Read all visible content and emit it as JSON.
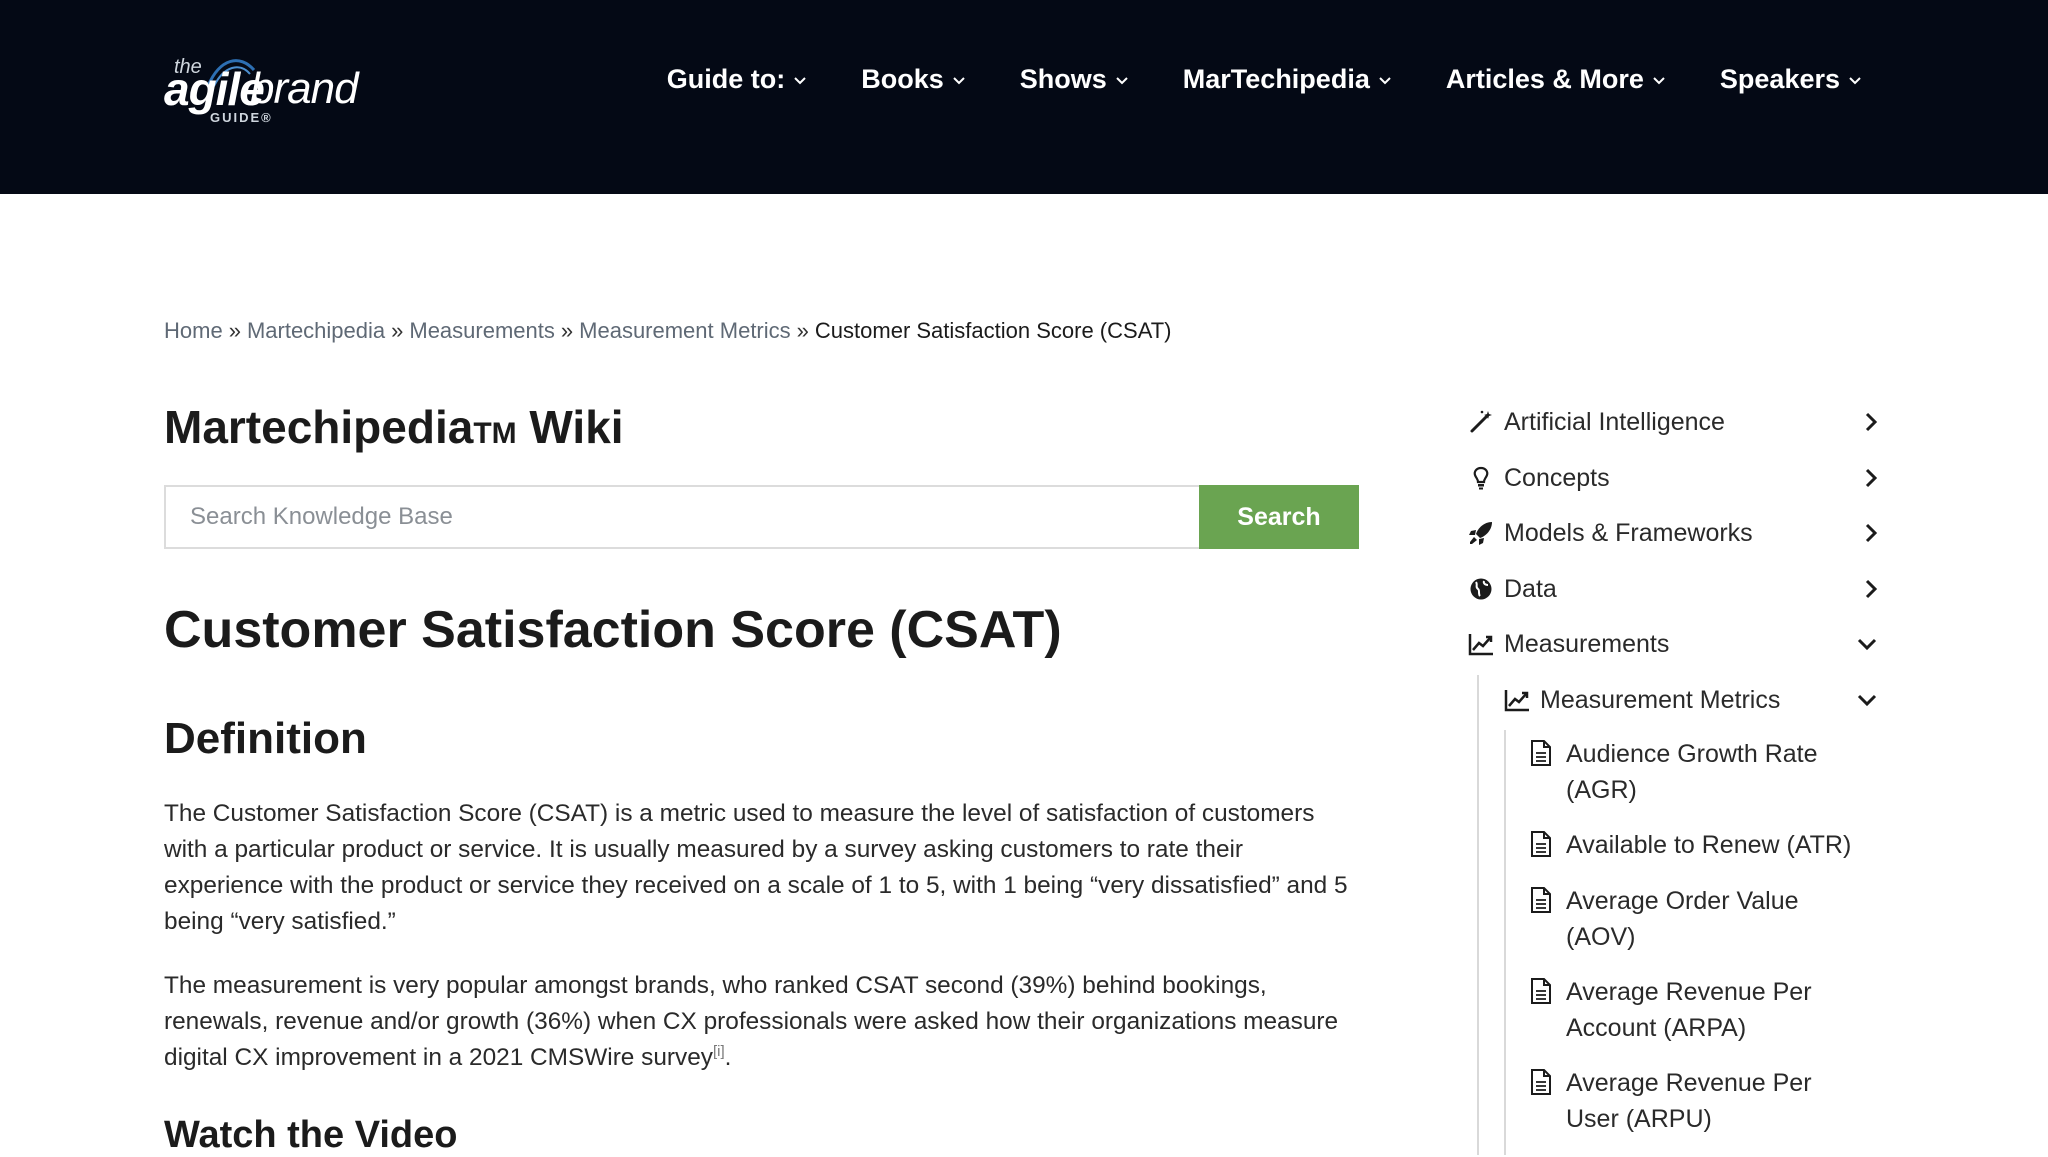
{
  "brand": {
    "logo_the": "the",
    "logo_agile": "agile",
    "logo_brand": "brand",
    "logo_guide": "GUIDE®"
  },
  "nav": {
    "items": [
      {
        "label": "Guide to:"
      },
      {
        "label": "Books"
      },
      {
        "label": "Shows"
      },
      {
        "label": "MarTechipedia"
      },
      {
        "label": "Articles & More"
      },
      {
        "label": "Speakers"
      }
    ]
  },
  "breadcrumb": {
    "items": [
      "Home",
      "Martechipedia",
      "Measurements",
      "Measurement Metrics"
    ],
    "separator": "»",
    "current": "Customer Satisfaction Score (CSAT)"
  },
  "wiki": {
    "title": "Martechipedia",
    "title_tm": "TM",
    "title_suffix": " Wiki"
  },
  "search": {
    "placeholder": "Search Knowledge Base",
    "button_label": "Search"
  },
  "article": {
    "title": "Customer Satisfaction Score (CSAT)",
    "definition_heading": "Definition",
    "paragraph1": "The Customer Satisfaction Score (CSAT) is a metric used to measure the level of satisfaction of customers with a particular product or service. It is usually measured by a survey asking customers to rate their experience with the product or service they received on a scale of 1 to 5, with 1 being “very dissatisfied” and 5 being “very satisfied.”",
    "paragraph2": "The measurement is very popular amongst brands, who ranked CSAT second (39%) behind bookings, renewals, revenue and/or growth (36%) when CX professionals were asked how their organizations measure digital CX improvement in a 2021 CMSWire survey",
    "footnote_ref": "[i]",
    "paragraph2_end": ".",
    "video_heading": "Watch the Video"
  },
  "sidebar": {
    "categories": [
      {
        "label": "Artificial Intelligence",
        "icon": "magic-wand-icon",
        "state": "collapsed"
      },
      {
        "label": "Concepts",
        "icon": "lightbulb-icon",
        "state": "collapsed"
      },
      {
        "label": "Models & Frameworks",
        "icon": "rocket-icon",
        "state": "collapsed"
      },
      {
        "label": "Data",
        "icon": "globe-icon",
        "state": "collapsed"
      },
      {
        "label": "Measurements",
        "icon": "line-chart-icon",
        "state": "expanded"
      }
    ],
    "subcategory": {
      "label": "Measurement Metrics",
      "icon": "line-chart-icon",
      "state": "expanded"
    },
    "documents": [
      {
        "label": "Audience Growth Rate (AGR)",
        "icon": "document-icon"
      },
      {
        "label": "Available to Renew (ATR)",
        "icon": "document-icon"
      },
      {
        "label": "Average Order Value (AOV)",
        "icon": "document-icon"
      },
      {
        "label": "Average Revenue Per Account (ARPA)",
        "icon": "document-icon"
      },
      {
        "label": "Average Revenue Per User (ARPU)",
        "icon": "document-icon"
      }
    ]
  },
  "colors": {
    "header_bg": "#040915",
    "search_button": "#6aa451",
    "text": "#1b1b1b"
  }
}
